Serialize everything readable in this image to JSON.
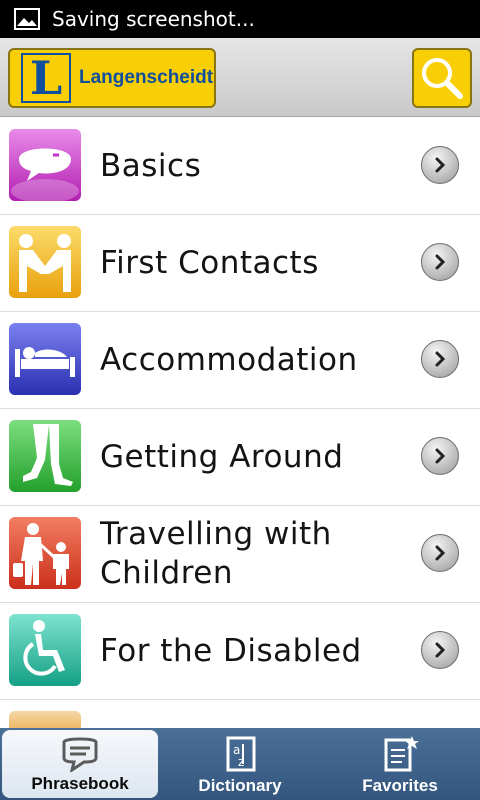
{
  "status_bar": {
    "text": "Saving screenshot..."
  },
  "header": {
    "logo_text": "Langenscheidt",
    "logo_letter": "L"
  },
  "list": {
    "items": [
      {
        "label": "Basics",
        "tile_color": "#c636c6",
        "icon": "speech-bubble-icon"
      },
      {
        "label": "First Contacts",
        "tile_color": "#f2b51a",
        "icon": "handshake-icon"
      },
      {
        "label": "Accommodation",
        "tile_color": "#3c43c8",
        "icon": "bed-icon"
      },
      {
        "label": "Getting Around",
        "tile_color": "#39b342",
        "icon": "walking-legs-icon"
      },
      {
        "label": "Travelling with Children",
        "tile_color": "#d9432b",
        "icon": "parent-child-icon"
      },
      {
        "label": "For the Disabled",
        "tile_color": "#27b79d",
        "icon": "wheelchair-icon"
      }
    ]
  },
  "tabs": [
    {
      "label": "Phrasebook",
      "icon": "phrasebook-icon",
      "active": true
    },
    {
      "label": "Dictionary",
      "icon": "dictionary-icon",
      "active": false
    },
    {
      "label": "Favorites",
      "icon": "favorites-icon",
      "active": false
    }
  ],
  "colors": {
    "brand_yellow": "#f8cf06",
    "brand_blue": "#0f4f9c",
    "tab_bar": "#3f6189"
  }
}
